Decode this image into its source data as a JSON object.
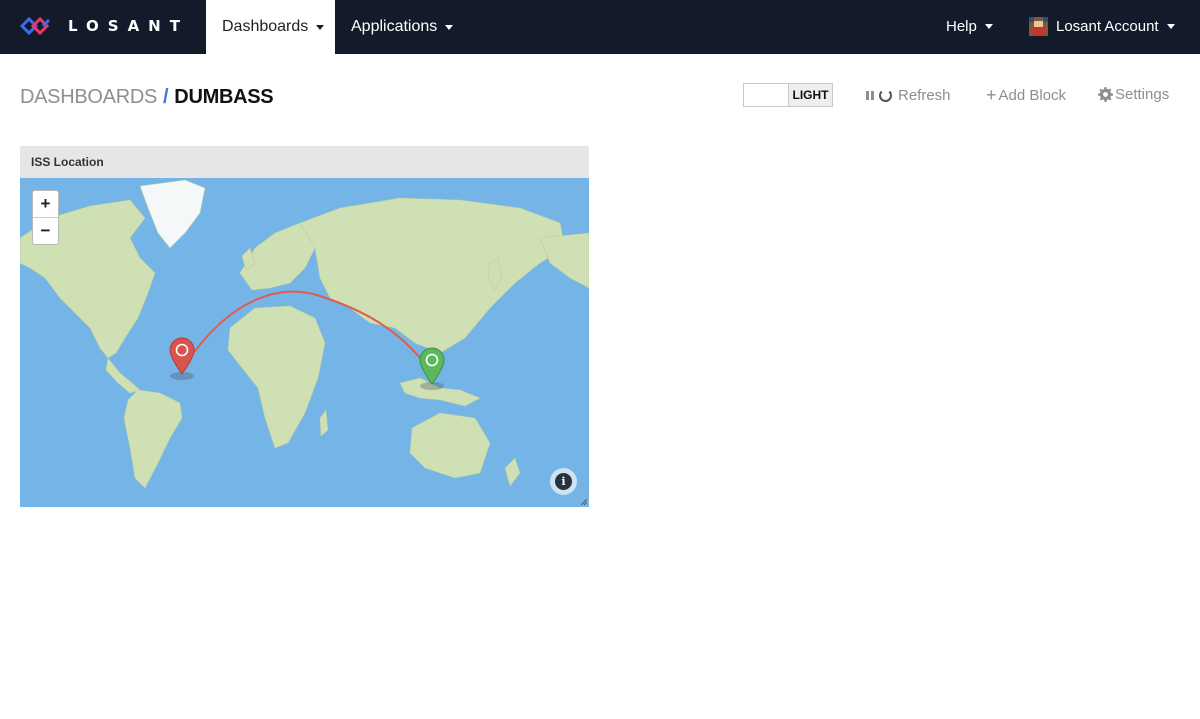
{
  "navbar": {
    "brand": "LOSANT",
    "items": [
      {
        "label": "Dashboards"
      },
      {
        "label": "Applications"
      }
    ],
    "help_label": "Help",
    "account_label": "Losant Account"
  },
  "header": {
    "breadcrumb_root": "DASHBOARDS",
    "breadcrumb_sep": "/",
    "breadcrumb_current": "DUMBASS",
    "theme_label": "LIGHT",
    "refresh_label": "Refresh",
    "add_block_label": "Add Block",
    "settings_label": "Settings"
  },
  "block": {
    "title": "ISS Location",
    "zoom_in": "+",
    "zoom_out": "−",
    "info_glyph": "i"
  },
  "colors": {
    "navbar": "#131b2b",
    "accent": "#4a72d9",
    "ocean": "#74b4e6",
    "land": "#cfe1b4",
    "path": "#e05c4f",
    "start_pin": "#d9534f",
    "end_pin": "#5cb85c"
  },
  "icons": [
    "losant-logo-icon",
    "caret-down-icon",
    "pause-icon",
    "spinner-icon",
    "plus-icon",
    "gear-icon",
    "info-icon",
    "map-pin-icon"
  ]
}
